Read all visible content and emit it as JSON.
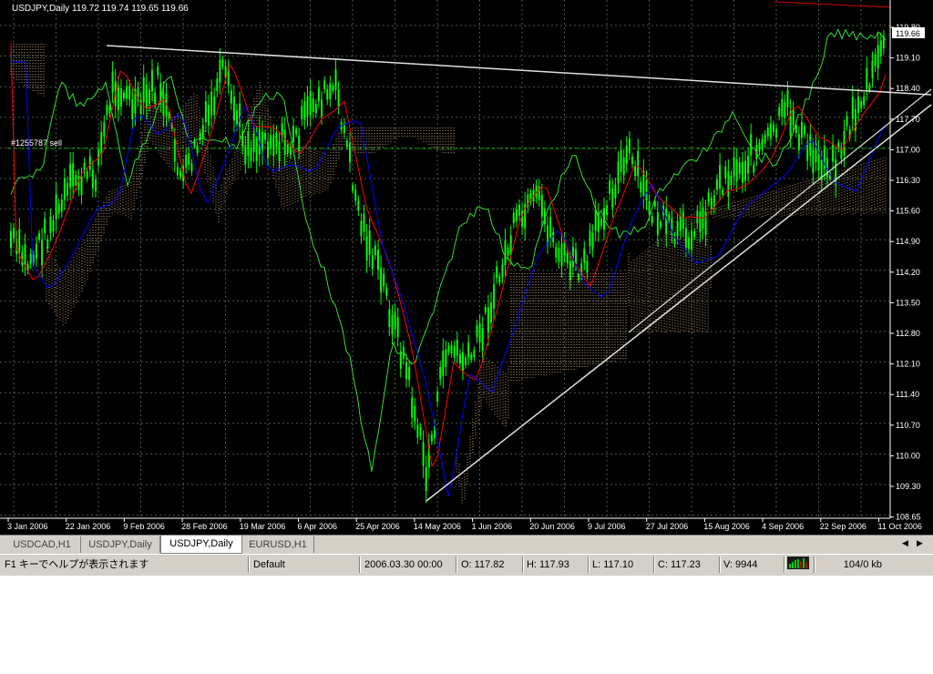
{
  "chart": {
    "title": "USDJPY,Daily",
    "ohlc": "119.72 119.74 119.65 119.66",
    "order_label": "#1255787 sell",
    "price_label_current": "119.66",
    "price_labels": [
      "119.80",
      "119.10",
      "118.40",
      "117.70",
      "117.00",
      "116.30",
      "115.60",
      "114.90",
      "114.20",
      "113.50",
      "112.80",
      "112.10",
      "111.40",
      "110.70",
      "110.00",
      "109.30",
      "108.65"
    ],
    "date_labels": [
      "3 Jan 2006",
      "22 Jan 2006",
      "9 Feb 2006",
      "28 Feb 2006",
      "19 Mar 2006",
      "6 Apr 2006",
      "25 Apr 2006",
      "14 May 2006",
      "1 Jun 2006",
      "20 Jun 2006",
      "9 Jul 2006",
      "27 Jul 2006",
      "15 Aug 2006",
      "4 Sep 2006",
      "22 Sep 2006",
      "11 Oct 2006"
    ],
    "colors": {
      "background": "#000000",
      "grid": "#4a5a4a",
      "candle": "#00ff00",
      "tenkan": "#ff0000",
      "kijun": "#0000ff",
      "chikou": "#33dd33",
      "cloud": "#ffcc99",
      "trendline": "#e0e0e0",
      "axis_text": "#ffffff"
    }
  },
  "tabs": [
    {
      "label": "USDCAD,H1",
      "active": false
    },
    {
      "label": "USDJPY,Daily",
      "active": false
    },
    {
      "label": "USDJPY,Daily",
      "active": true
    },
    {
      "label": "EURUSD,H1",
      "active": false
    }
  ],
  "status": {
    "help": "F1 キーでヘルプが表示されます",
    "profile": "Default",
    "datetime": "2006.03.30 00:00",
    "open": "O: 117.82",
    "high": "H: 117.93",
    "low": "L: 117.10",
    "close": "C: 117.23",
    "volume": "V: 9944",
    "traffic": "104/0 kb"
  },
  "icons": {
    "tab_left": "arrow-left-icon",
    "tab_right": "arrow-right-icon",
    "connection": "connection-bars-icon"
  }
}
